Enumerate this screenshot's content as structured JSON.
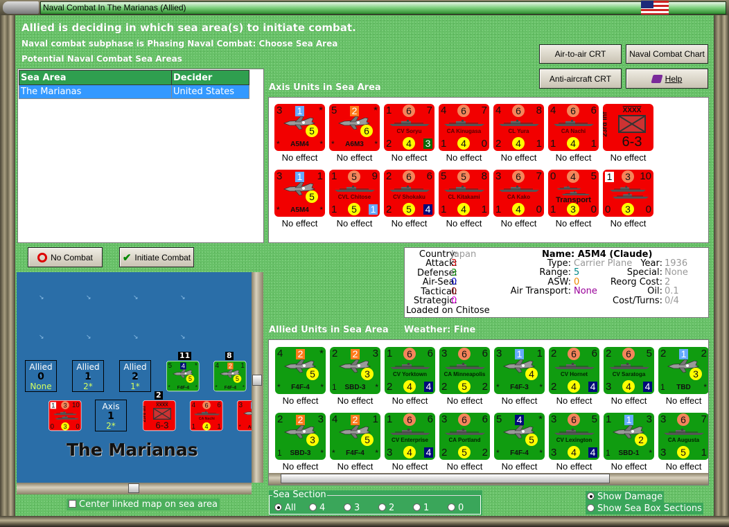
{
  "window": {
    "title": "Naval Combat In The Marianas (Allied)"
  },
  "header": {
    "line1": "Allied is deciding in which sea area(s) to initiate combat.",
    "line2": "Naval combat subphase is Phasing Naval Combat: Choose Sea Area",
    "line3": "Potential Naval Combat Sea Areas"
  },
  "sea_table": {
    "columns": [
      "Sea Area",
      "Decider"
    ],
    "rows": [
      {
        "sea_area": "The Marianas",
        "decider": "United States"
      }
    ]
  },
  "buttons": {
    "air_to_air": "Air-to-air CRT",
    "naval_chart": "Naval Combat Chart",
    "anti_aircraft": "Anti-aircraft CRT",
    "help": "Help",
    "no_combat": "No Combat",
    "initiate": "Initiate Combat"
  },
  "axis_label": "Axis Units in Sea Area",
  "allied_label": "Allied Units in Sea Area",
  "weather": "Weather:  Fine",
  "info": {
    "country_l": "Country:",
    "country": "Japan",
    "attack_l": "Attack:",
    "attack": "3",
    "defense_l": "Defense:",
    "defense": "3",
    "airsea_l": "Air-Sea:",
    "airsea": "0",
    "tactical_l": "Tactical:",
    "tactical": "0",
    "strategic_l": "Strategic:",
    "strategic": "0",
    "loaded": "Loaded on Chitose",
    "name": "Name: A5M4 (Claude)",
    "type_l": "Type:",
    "type": "Carrier Plane",
    "range_l": "Range:",
    "range": "5",
    "asw_l": "ASW:",
    "asw": "0",
    "airtrans_l": "Air Transport:",
    "airtrans": "None",
    "year_l": "Year:",
    "year": "1936",
    "special_l": "Special:",
    "special": "None",
    "reorg_l": "Reorg Cost:",
    "reorg": "2",
    "oil_l": "Oil:",
    "oil": "0.1",
    "cost_l": "Cost/Turns:",
    "cost": "0/4"
  },
  "colors": {
    "axis": "#f20000",
    "allied": "#109c10",
    "circle": "#f4855a",
    "yellow": "#ffff00",
    "lightblue": "#66aaff",
    "orange": "#ff7a1a",
    "navy": "#000a7a",
    "darkgreen": "#0a6a0a",
    "white": "#ffffff"
  },
  "axis_units": [
    [
      {
        "kind": "plane",
        "tl": "3",
        "sq": "1",
        "sqc": "lightblue",
        "tr": "*",
        "mid": "5",
        "bl": "*",
        "name": "A5M4",
        "br": "*",
        "status": "No effect"
      },
      {
        "kind": "plane",
        "tl": "5",
        "sq": "2",
        "sqc": "orange",
        "tr": "*",
        "mid": "6",
        "bl": "*",
        "name": "A6M3",
        "br": "*",
        "status": "No effect"
      },
      {
        "kind": "ship",
        "tl": "1",
        "tc": "6",
        "tr": "7",
        "name": "CV Soryu",
        "bl": "2",
        "bc": "4",
        "br": "3",
        "brc": "darkgreen",
        "status": "No effect"
      },
      {
        "kind": "ship",
        "tl": "4",
        "tc": "6",
        "tr": "7",
        "name": "CA Kinugasa",
        "bl": "1",
        "bc": "4",
        "br": "0",
        "status": "No effect"
      },
      {
        "kind": "ship",
        "tl": "4",
        "tc": "6",
        "tr": "8",
        "name": "CL Yura",
        "bl": "2",
        "bc": "4",
        "br": "1",
        "status": "No effect"
      },
      {
        "kind": "ship",
        "tl": "4",
        "tc": "6",
        "tr": "6",
        "name": "CA Nachi",
        "bl": "1",
        "bc": "4",
        "br": "1",
        "status": "No effect"
      },
      {
        "kind": "army",
        "name": "23rd Inf",
        "size": "XXXX",
        "str": "6-3",
        "status": "No effect"
      }
    ],
    [
      {
        "kind": "plane",
        "tl": "3",
        "sq": "1",
        "sqc": "lightblue",
        "tr": "1",
        "mid": "5",
        "bl": "*",
        "name": "A5M4",
        "br": "*",
        "status": "No effect"
      },
      {
        "kind": "ship",
        "tl": "1",
        "tc": "5",
        "tr": "9",
        "name": "CVL Chitose",
        "bl": "1",
        "bc": "5",
        "br": "1",
        "brc": "lightblue",
        "status": "No effect"
      },
      {
        "kind": "ship",
        "tl": "2",
        "tc": "6",
        "tr": "6",
        "name": "CV Shokaku",
        "bl": "2",
        "bc": "5",
        "br": "4",
        "brc": "navy",
        "status": "No effect"
      },
      {
        "kind": "ship",
        "tl": "5",
        "tc": "5",
        "tr": "8",
        "name": "CL Kitakami",
        "bl": "1",
        "bc": "4",
        "br": "1",
        "status": "No effect"
      },
      {
        "kind": "ship",
        "tl": "3",
        "tc": "6",
        "tr": "7",
        "name": "CA Kako",
        "bl": "1",
        "bc": "4",
        "br": "0",
        "status": "No effect"
      },
      {
        "kind": "transport",
        "tl": "0",
        "tc": "4",
        "tr": "5",
        "name": "Transport",
        "bl": "1",
        "bc": "3",
        "br": "0",
        "status": "No effect"
      },
      {
        "kind": "convoy",
        "tlsq": "1",
        "tc": "3",
        "tr": "10",
        "name": "",
        "bl": "0",
        "bc": "3",
        "br": "0",
        "status": "No effect"
      }
    ]
  ],
  "allied_units": [
    [
      {
        "kind": "plane",
        "tl": "4",
        "sq": "2",
        "sqc": "orange",
        "tr": "*",
        "mid": "5",
        "bl": "*",
        "name": "F4F-4",
        "br": "*",
        "status": "No effect"
      },
      {
        "kind": "plane",
        "tl": "2",
        "sq": "2",
        "sqc": "orange",
        "tr": "3",
        "mid": "3",
        "bl": "1",
        "name": "SBD-3",
        "br": "*",
        "status": "No effect"
      },
      {
        "kind": "ship",
        "tl": "1",
        "tc": "6",
        "tr": "6",
        "name": "CV Yorktown",
        "bl": "2",
        "bc": "4",
        "br": "4",
        "brc": "navy",
        "status": "No effect"
      },
      {
        "kind": "ship",
        "tl": "3",
        "tc": "6",
        "tr": "6",
        "name": "CA Minneapolis",
        "bl": "2",
        "bc": "5",
        "br": "2",
        "status": "No effect"
      },
      {
        "kind": "plane",
        "tl": "3",
        "sq": "1",
        "sqc": "lightblue",
        "tr": "1",
        "mid": "4",
        "bl": "*",
        "name": "F4F-3",
        "br": "*",
        "status": "No effect"
      },
      {
        "kind": "ship",
        "tl": "2",
        "tc": "6",
        "tr": "6",
        "name": "CV Hornet",
        "bl": "2",
        "bc": "4",
        "br": "4",
        "brc": "navy",
        "status": "No effect"
      },
      {
        "kind": "ship",
        "tl": "2",
        "tc": "6",
        "tr": "5",
        "name": "CV Saratoga",
        "bl": "3",
        "bc": "4",
        "br": "4",
        "brc": "navy",
        "status": "No effect"
      },
      {
        "kind": "plane",
        "tl": "2",
        "sq": "1",
        "sqc": "lightblue",
        "tr": "2",
        "mid": "3",
        "bl": "1",
        "name": "TBD",
        "br": "*",
        "status": "No effect"
      }
    ],
    [
      {
        "kind": "plane",
        "tl": "2",
        "sq": "2",
        "sqc": "orange",
        "tr": "3",
        "mid": "3",
        "bl": "1",
        "name": "SBD-3",
        "br": "*",
        "status": "No effect"
      },
      {
        "kind": "plane",
        "tl": "4",
        "sq": "2",
        "sqc": "orange",
        "tr": "1",
        "mid": "5",
        "bl": "*",
        "name": "F4F-4",
        "br": "*",
        "status": "No effect"
      },
      {
        "kind": "ship",
        "tl": "1",
        "tc": "6",
        "tr": "6",
        "name": "CV Enterprise",
        "bl": "3",
        "bc": "4",
        "br": "4",
        "brc": "navy",
        "status": "No effect"
      },
      {
        "kind": "ship",
        "tl": "3",
        "tc": "6",
        "tr": "6",
        "name": "CA Portland",
        "bl": "2",
        "bc": "5",
        "br": "2",
        "status": "No effect"
      },
      {
        "kind": "plane",
        "tl": "5",
        "sq": "4",
        "sqc": "navy",
        "tr": "*",
        "mid": "5",
        "bl": "*",
        "name": "F4F-4",
        "br": "*",
        "status": "No effect"
      },
      {
        "kind": "ship",
        "tl": "3",
        "tc": "6",
        "tr": "5",
        "name": "CV Lexington",
        "bl": "3",
        "bc": "4",
        "br": "4",
        "brc": "navy",
        "status": "No effect"
      },
      {
        "kind": "plane",
        "tl": "1",
        "sq": "1",
        "sqc": "lightblue",
        "tr": "3",
        "mid": "2",
        "bl": "1",
        "name": "SBD-1",
        "br": "*",
        "status": "No effect"
      },
      {
        "kind": "ship",
        "tl": "3",
        "tc": "6",
        "tr": "7",
        "name": "CA Augusta",
        "bl": "3",
        "bc": "5",
        "br": "1",
        "status": "No effect"
      }
    ]
  ],
  "map": {
    "sea_name": "The Marianas",
    "sea_boxes": [
      {
        "side": "Allied",
        "num": "1",
        "val": "None",
        "label_num": "0"
      },
      {
        "side": "Allied",
        "label_num": "1",
        "val": "2*"
      },
      {
        "side": "Allied",
        "label_num": "2",
        "val": "1*"
      },
      {
        "side": "Axis",
        "label_num": "1",
        "val": "2*"
      }
    ],
    "stacks": [
      {
        "side": "allied",
        "count": "11",
        "unit": {
          "kind": "plane",
          "tl": "5",
          "sq": "4",
          "sqc": "navy",
          "tr": "*",
          "mid": "5",
          "bl": "*",
          "name": "F4F-4",
          "br": "*"
        }
      },
      {
        "side": "allied",
        "count": "8",
        "unit": {
          "kind": "plane",
          "tl": "4",
          "sq": "2",
          "sqc": "orange",
          "tr": "1",
          "mid": "5",
          "bl": "*",
          "name": "F4F-4",
          "br": "*"
        }
      },
      {
        "side": "axis",
        "count": "",
        "unit": {
          "kind": "convoy",
          "tlsq": "1",
          "tc": "3",
          "tr": "10",
          "name": "",
          "bl": "0",
          "bc": "3",
          "br": "0"
        }
      },
      {
        "side": "axis",
        "count": "2",
        "unit": {
          "kind": "army",
          "name": "23rd Inf",
          "size": "XXXX",
          "str": "6-3"
        }
      },
      {
        "side": "axis",
        "count": "",
        "unit": {
          "kind": "ship",
          "tl": "4",
          "tc": "6",
          "tr": "6",
          "name": "CA Nachi",
          "bl": "1",
          "bc": "4",
          "br": "1"
        }
      },
      {
        "side": "axis",
        "count": "",
        "unit": {
          "kind": "plane",
          "tl": "3",
          "sq": "1",
          "sqc": "lightblue",
          "tr": "1",
          "mid": "5",
          "bl": "*",
          "name": "A5M4",
          "br": "*"
        }
      }
    ],
    "center_checkbox": "Center linked map on sea area"
  },
  "sea_section": {
    "legend": "Sea Section",
    "options": [
      "All",
      "4",
      "3",
      "2",
      "1",
      "0"
    ],
    "selected": "All"
  },
  "display": {
    "show_damage": "Show Damage",
    "show_sections": "Show Sea Box Sections",
    "selected": "show_damage"
  }
}
